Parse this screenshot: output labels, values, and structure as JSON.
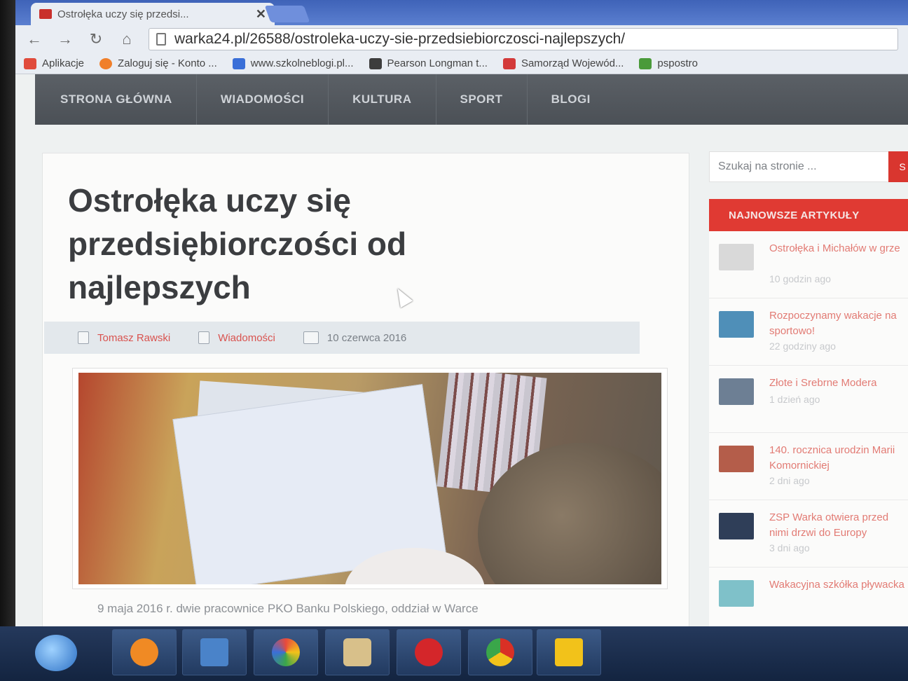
{
  "browser": {
    "tab_title": "Ostrołęka uczy się przedsi...",
    "url": "warka24.pl/26588/ostroleka-uczy-sie-przedsiebiorczosci-najlepszych/",
    "bookmarks": [
      {
        "label": "Aplikacje",
        "color": "#e04b3c"
      },
      {
        "label": "Zaloguj się - Konto ...",
        "color": "#f07f2a"
      },
      {
        "label": "www.szkolneblogi.pl...",
        "color": "#3a6fd8"
      },
      {
        "label": "Pearson Longman t...",
        "color": "#3d3d3d"
      },
      {
        "label": "Samorząd Wojewód...",
        "color": "#d33a3a"
      },
      {
        "label": "pspostro",
        "color": "#4a9a3a"
      }
    ]
  },
  "nav": {
    "items": [
      "STRONA GŁÓWNA",
      "WIADOMOŚCI",
      "KULTURA",
      "SPORT",
      "BLOGI"
    ]
  },
  "article": {
    "title": "Ostrołęka uczy się przedsiębiorczości od najlepszych",
    "author": "Tomasz Rawski",
    "category": "Wiadomości",
    "date": "10 czerwca 2016",
    "text": "9 maja 2016 r. dwie pracownice PKO Banku Polskiego, oddział w Warce"
  },
  "sidebar": {
    "search_placeholder": "Szukaj na stronie ...",
    "search_button": "S",
    "latest_heading": "NAJNOWSZE ARTYKUŁY",
    "latest": [
      {
        "title": "Ostrołęka i Michałów w grze",
        "time": "10 godzin ago",
        "thumb": "#d9d9d9"
      },
      {
        "title": "Rozpoczynamy wakacje na sportowo!",
        "time": "22 godziny ago",
        "thumb": "#4f8fb8"
      },
      {
        "title": "Złote i Srebrne Modera",
        "time": "1 dzień ago",
        "thumb": "#6d7f94"
      },
      {
        "title": "140. rocznica urodzin Marii Komornickiej",
        "time": "2 dni ago",
        "thumb": "#b45d4a"
      },
      {
        "title": "ZSP Warka otwiera przed nimi drzwi do Europy",
        "time": "3 dni ago",
        "thumb": "#2f3e58"
      },
      {
        "title": "Wakacyjna szkółka pływacka",
        "time": "",
        "thumb": "#7fc1c9"
      }
    ]
  },
  "taskbar": {
    "apps": [
      {
        "name": "media-player",
        "color": "#f08a24"
      },
      {
        "name": "file-explorer",
        "color": "#4a83c9"
      },
      {
        "name": "photos",
        "color": "#e8b93a"
      },
      {
        "name": "paint",
        "color": "#d8c08a"
      },
      {
        "name": "opera",
        "color": "#d4262a"
      },
      {
        "name": "chrome",
        "color": "#3aa64a"
      },
      {
        "name": "warning",
        "color": "#f2c21a"
      }
    ]
  }
}
